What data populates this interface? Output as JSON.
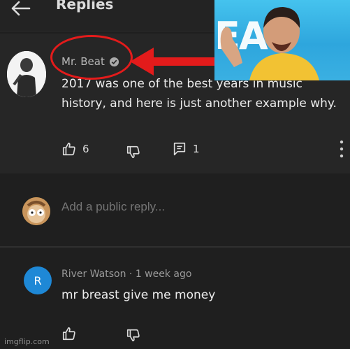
{
  "header": {
    "title": "Replies"
  },
  "comment": {
    "author": "Mr. Beat",
    "time": "",
    "text": "2017 was one of the best years in music history, and here is just another example why.",
    "like_count": "6",
    "reply_count": "1"
  },
  "thumbnail": {
    "text": "EAS"
  },
  "reply_box": {
    "placeholder": "Add a public reply..."
  },
  "reply": {
    "avatar_letter": "R",
    "meta": "River Watson · 1 week ago",
    "text": "mr breast give me  money"
  },
  "watermark": "imgflip.com",
  "colors": {
    "background": "#1f1f1f",
    "highlight": "#e31b1b",
    "reply_avatar": "#1e88d6",
    "thumbnail_bg": "#3ab0e2"
  },
  "icons": [
    "back-arrow-icon",
    "verified-icon",
    "thumbs-up-icon",
    "thumbs-down-icon",
    "reply-icon",
    "more-vert-icon"
  ]
}
